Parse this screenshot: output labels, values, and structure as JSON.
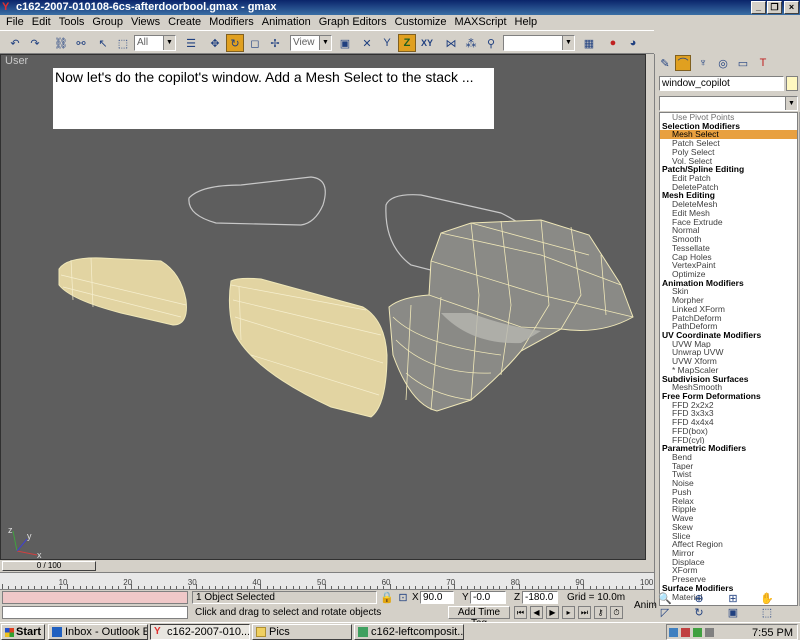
{
  "window": {
    "title": "c162-2007-010108-6cs-afterdoorbool.gmax - gmax",
    "icon": "gmax-icon",
    "controls": [
      "minimize-icon",
      "restore-icon",
      "close-icon"
    ]
  },
  "menu": [
    "File",
    "Edit",
    "Tools",
    "Group",
    "Views",
    "Create",
    "Modifiers",
    "Animation",
    "Graph Editors",
    "Customize",
    "MAXScript",
    "Help"
  ],
  "toolbar": {
    "filter_value": "All",
    "refcoord_value": "View",
    "z_label": "Z",
    "xy_label": "XY",
    "named_sel_value": ""
  },
  "viewport": {
    "label": "User",
    "instruction": "Now let's do the copilot's window.  Add a Mesh Select to the stack ...",
    "bg_color": "#5e5e5e",
    "shape_fill": "#e2d4a2",
    "wire_color": "#f0e8b8",
    "axis_x": "x",
    "axis_y": "y",
    "axis_z": "z"
  },
  "command_panel": {
    "object_name": "window_copilot",
    "swatch_color": "#fff8c0",
    "pivot_item": "Use Pivot Points",
    "modifier_list": [
      {
        "type": "head",
        "label": "Selection Modifiers"
      },
      {
        "type": "item",
        "label": "Mesh Select",
        "selected": true
      },
      {
        "type": "item",
        "label": "Patch Select"
      },
      {
        "type": "item",
        "label": "Poly Select"
      },
      {
        "type": "item",
        "label": "Vol. Select"
      },
      {
        "type": "head",
        "label": "Patch/Spline Editing"
      },
      {
        "type": "item",
        "label": "Edit Patch"
      },
      {
        "type": "item",
        "label": "DeletePatch"
      },
      {
        "type": "head",
        "label": "Mesh Editing"
      },
      {
        "type": "item",
        "label": "DeleteMesh"
      },
      {
        "type": "item",
        "label": "Edit Mesh"
      },
      {
        "type": "item",
        "label": "Face Extrude"
      },
      {
        "type": "item",
        "label": "Normal"
      },
      {
        "type": "item",
        "label": "Smooth"
      },
      {
        "type": "item",
        "label": "Tessellate"
      },
      {
        "type": "item",
        "label": "Cap Holes"
      },
      {
        "type": "item",
        "label": "VertexPaint"
      },
      {
        "type": "item",
        "label": "Optimize"
      },
      {
        "type": "head",
        "label": "Animation Modifiers"
      },
      {
        "type": "item",
        "label": "Skin"
      },
      {
        "type": "item",
        "label": "Morpher"
      },
      {
        "type": "item",
        "label": "Linked XForm"
      },
      {
        "type": "item",
        "label": "PatchDeform"
      },
      {
        "type": "item",
        "label": "PathDeform"
      },
      {
        "type": "head",
        "label": "UV Coordinate Modifiers"
      },
      {
        "type": "item",
        "label": "UVW Map"
      },
      {
        "type": "item",
        "label": "Unwrap UVW"
      },
      {
        "type": "item",
        "label": "UVW Xform"
      },
      {
        "type": "item",
        "label": "* MapScaler"
      },
      {
        "type": "head",
        "label": "Subdivision Surfaces"
      },
      {
        "type": "item",
        "label": "MeshSmooth"
      },
      {
        "type": "head",
        "label": "Free Form Deformations"
      },
      {
        "type": "item",
        "label": "FFD 2x2x2"
      },
      {
        "type": "item",
        "label": "FFD 3x3x3"
      },
      {
        "type": "item",
        "label": "FFD 4x4x4"
      },
      {
        "type": "item",
        "label": "FFD(box)"
      },
      {
        "type": "item",
        "label": "FFD(cyl)"
      },
      {
        "type": "head",
        "label": "Parametric Modifiers"
      },
      {
        "type": "item",
        "label": "Bend"
      },
      {
        "type": "item",
        "label": "Taper"
      },
      {
        "type": "item",
        "label": "Twist"
      },
      {
        "type": "item",
        "label": "Noise"
      },
      {
        "type": "item",
        "label": "Push"
      },
      {
        "type": "item",
        "label": "Relax"
      },
      {
        "type": "item",
        "label": "Ripple"
      },
      {
        "type": "item",
        "label": "Wave"
      },
      {
        "type": "item",
        "label": "Skew"
      },
      {
        "type": "item",
        "label": "Slice"
      },
      {
        "type": "item",
        "label": "Affect Region"
      },
      {
        "type": "item",
        "label": "Mirror"
      },
      {
        "type": "item",
        "label": "Displace"
      },
      {
        "type": "item",
        "label": "XForm"
      },
      {
        "type": "item",
        "label": "Preserve"
      },
      {
        "type": "head",
        "label": "Surface Modifiers"
      },
      {
        "type": "item",
        "label": "Material"
      }
    ]
  },
  "timeline": {
    "frame_readout": "0 / 100",
    "tick_labels": [
      "10",
      "20",
      "30",
      "40",
      "50",
      "60",
      "70",
      "80",
      "90",
      "100"
    ]
  },
  "status": {
    "selection": "1 Object Selected",
    "prompt": "Click and drag to select and rotate objects",
    "x_label": "X",
    "x_value": "90.0",
    "y_label": "Y",
    "y_value": "-0.0",
    "z_label": "Z",
    "z_value": "-180.0",
    "grid": "Grid = 10.0m",
    "add_time_tag": "Add Time Tag",
    "anim": "Anim"
  },
  "taskbar": {
    "start": "Start",
    "tasks": [
      {
        "label": "Inbox - Outlook E...",
        "icon": "outlook-icon",
        "active": false
      },
      {
        "label": "c162-2007-010...",
        "icon": "gmax-icon",
        "active": true
      },
      {
        "label": "Pics",
        "icon": "folder-icon",
        "active": false
      },
      {
        "label": "c162-leftcomposit...",
        "icon": "image-icon",
        "active": false
      }
    ],
    "clock": "7:55 PM"
  }
}
